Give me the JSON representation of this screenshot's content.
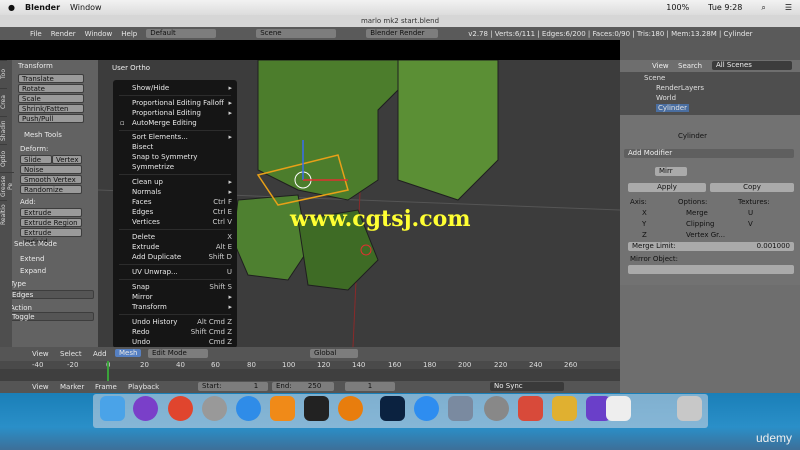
{
  "mac_menu": {
    "app": "Blender",
    "window": "Window",
    "clock": "Tue 9:28",
    "battery": "100%"
  },
  "title": "marlo mk2 start.blend",
  "info_header": {
    "file": "File",
    "render": "Render",
    "window": "Window",
    "help": "Help",
    "layout": "Default",
    "scene": "Scene",
    "engine": "Blender Render",
    "stats": "v2.78 | Verts:6/111 | Edges:6/200 | Faces:0/90 | Tris:180 | Mem:13.28M | Cylinder"
  },
  "tool_tabs": [
    "Too",
    "Crea",
    "Shadin",
    "Optio",
    "Grease Pe",
    "Realtio"
  ],
  "tools": {
    "transform": "Transform",
    "translate": "Translate",
    "rotate": "Rotate",
    "scale": "Scale",
    "shrink": "Shrink/Fatten",
    "push": "Push/Pull",
    "mesh_tools": "Mesh Tools",
    "deform": "Deform:",
    "slide": "Slide Ed",
    "vertex": "Vertex",
    "noise": "Noise",
    "smooth": "Smooth Vertex",
    "randomize": "Randomize",
    "add": "Add:",
    "extrude": "Extrude",
    "extrude_region": "Extrude Region",
    "extrude_indiv": "Extrude Individ...",
    "select_mode": "Select Mode",
    "extend": "Extend",
    "expand": "Expand",
    "type": "Type",
    "edges": "Edges",
    "action": "Action",
    "toggle": "Toggle"
  },
  "viewport": {
    "label": "User Ortho",
    "watermark": "www.cgtsj.com"
  },
  "menu": [
    {
      "label": "Show/Hide",
      "shortcut": "▸"
    },
    {
      "label": "Proportional Editing Falloff",
      "shortcut": "▸"
    },
    {
      "label": "Proportional Editing",
      "shortcut": "▸"
    },
    {
      "label": "AutoMerge Editing",
      "shortcut": ""
    },
    {
      "label": "Sort Elements...",
      "shortcut": "▸"
    },
    {
      "label": "Bisect",
      "shortcut": ""
    },
    {
      "label": "Snap to Symmetry",
      "shortcut": ""
    },
    {
      "label": "Symmetrize",
      "shortcut": ""
    },
    {
      "label": "Clean up",
      "shortcut": "▸"
    },
    {
      "label": "Normals",
      "shortcut": "▸"
    },
    {
      "label": "Faces",
      "shortcut": "Ctrl F"
    },
    {
      "label": "Edges",
      "shortcut": "Ctrl E"
    },
    {
      "label": "Vertices",
      "shortcut": "Ctrl V"
    },
    {
      "label": "Delete",
      "shortcut": "X"
    },
    {
      "label": "Extrude",
      "shortcut": "Alt E"
    },
    {
      "label": "Add Duplicate",
      "shortcut": "Shift D"
    },
    {
      "label": "UV Unwrap...",
      "shortcut": "U"
    },
    {
      "label": "Snap",
      "shortcut": "Shift S"
    },
    {
      "label": "Mirror",
      "shortcut": "▸"
    },
    {
      "label": "Transform",
      "shortcut": "▸"
    },
    {
      "label": "Undo History",
      "shortcut": "Alt Cmd Z"
    },
    {
      "label": "Redo",
      "shortcut": "Shift Cmd Z"
    },
    {
      "label": "Undo",
      "shortcut": "Cmd Z"
    }
  ],
  "vp_header": {
    "view": "View",
    "select": "Select",
    "add": "Add",
    "mesh": "Mesh",
    "mode": "Edit Mode",
    "orient": "Global"
  },
  "timeline": {
    "ticks": [
      "-40",
      "-20",
      "0",
      "20",
      "40",
      "60",
      "80",
      "100",
      "120",
      "140",
      "160",
      "180",
      "200",
      "220",
      "240",
      "260"
    ],
    "view": "View",
    "marker": "Marker",
    "frame": "Frame",
    "playback": "Playback",
    "start": "Start:",
    "start_val": "1",
    "end": "End:",
    "end_val": "250",
    "current": "1",
    "sync": "No Sync"
  },
  "outliner": {
    "view": "View",
    "search": "Search",
    "scenes": "All Scenes",
    "items": [
      "Scene",
      "RenderLayers",
      "World",
      "Cylinder"
    ]
  },
  "props": {
    "object": "Cylinder",
    "add_modifier": "Add Modifier",
    "mirror": "Mirr",
    "apply": "Apply",
    "copy": "Copy",
    "axis": "Axis:",
    "options": "Options:",
    "textures": "Textures:",
    "x": "X",
    "y": "Y",
    "z": "Z",
    "merge": "Merge",
    "clipping": "Clipping",
    "vertex_gr": "Vertex Gr...",
    "u": "U",
    "v": "V",
    "merge_limit": "Merge Limit:",
    "merge_val": "0.001000",
    "mirror_obj": "Mirror Object:"
  },
  "udemy": "udemy"
}
